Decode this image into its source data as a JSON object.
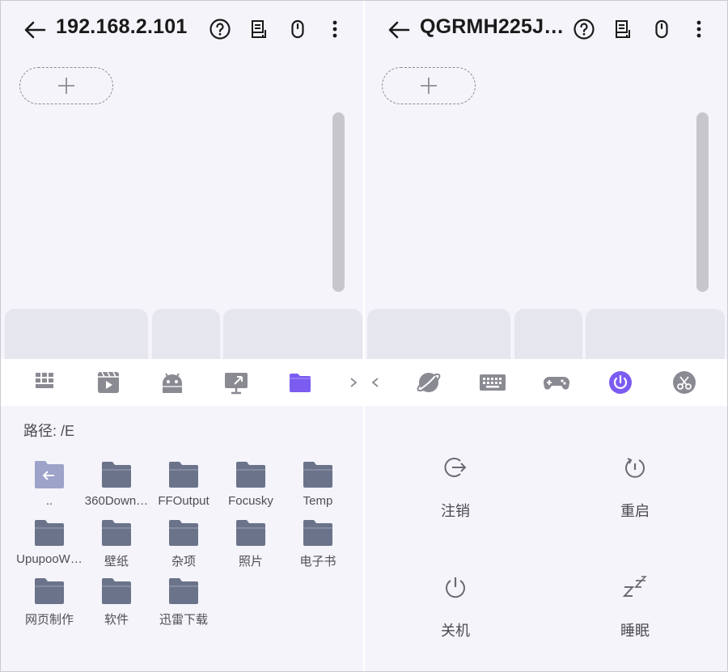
{
  "left_panel": {
    "title": "192.168.2.101",
    "path_label": "路径: /E",
    "folders": [
      {
        "name": "..",
        "type": "up"
      },
      {
        "name": "360Down…",
        "type": "folder"
      },
      {
        "name": "FFOutput",
        "type": "folder"
      },
      {
        "name": "Focusky",
        "type": "folder"
      },
      {
        "name": "Temp",
        "type": "folder"
      },
      {
        "name": "UpupooW…",
        "type": "folder"
      },
      {
        "name": "壁纸",
        "type": "folder"
      },
      {
        "name": "杂项",
        "type": "folder"
      },
      {
        "name": "照片",
        "type": "folder"
      },
      {
        "name": "电子书",
        "type": "folder"
      },
      {
        "name": "网页制作",
        "type": "folder"
      },
      {
        "name": "软件",
        "type": "folder"
      },
      {
        "name": "迅雷下载",
        "type": "folder"
      }
    ],
    "tool_icons": [
      "apps-grid-icon",
      "media-player-icon",
      "android-icon",
      "screen-cast-icon",
      "folder-icon"
    ],
    "active_tool": "folder-icon",
    "next_arrow": "chevron-right-icon"
  },
  "right_panel": {
    "title": "QGRMH225J…",
    "prev_arrow": "chevron-left-icon",
    "tool_icons": [
      "browser-icon",
      "keyboard-icon",
      "gamepad-icon",
      "power-icon",
      "cut-icon"
    ],
    "active_tool": "power-icon",
    "power_actions": [
      {
        "label": "注销",
        "icon": "logout-icon"
      },
      {
        "label": "重启",
        "icon": "restart-icon"
      },
      {
        "label": "关机",
        "icon": "shutdown-icon"
      },
      {
        "label": "睡眠",
        "icon": "sleep-icon"
      }
    ]
  },
  "colors": {
    "accent": "#7b5cf0",
    "icon_gray": "#8a8a93",
    "folder": "#6b738a",
    "background": "#f4f4fa"
  }
}
